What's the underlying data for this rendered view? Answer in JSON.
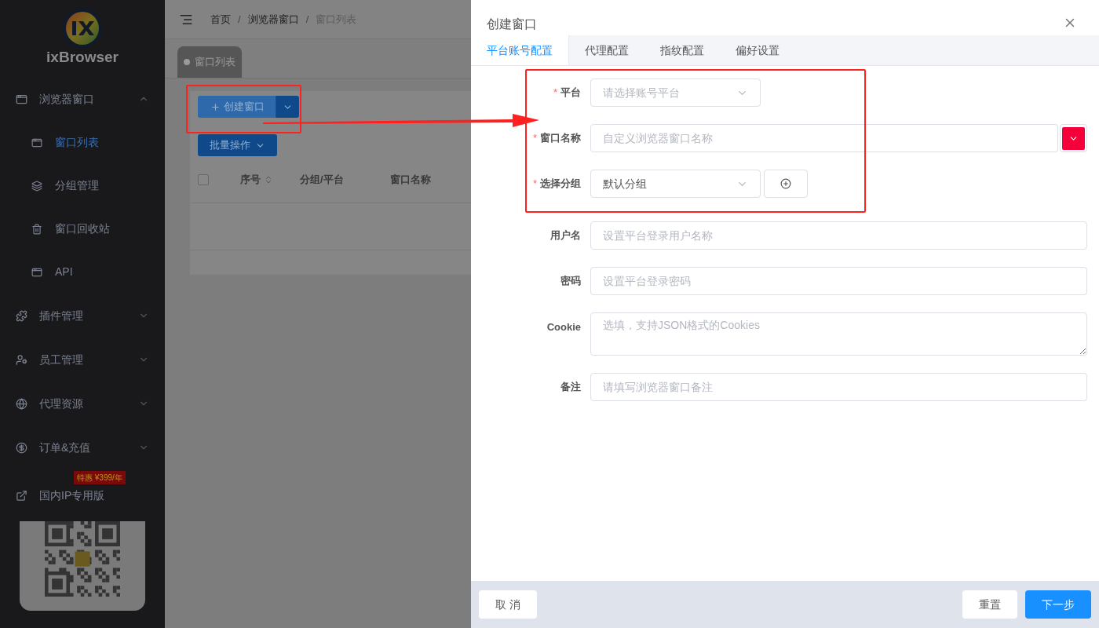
{
  "sidebar": {
    "logo_text": "ixBrowser",
    "items": [
      {
        "label": "浏览器窗口",
        "expanded": true,
        "selected": false,
        "children": [
          {
            "label": "窗口列表",
            "selected": true
          },
          {
            "label": "分组管理",
            "selected": false
          },
          {
            "label": "窗口回收站",
            "selected": false
          },
          {
            "label": "API",
            "selected": false
          }
        ]
      },
      {
        "label": "插件管理",
        "expanded": false,
        "selected": false
      },
      {
        "label": "员工管理",
        "expanded": false,
        "selected": false
      },
      {
        "label": "代理资源",
        "expanded": false,
        "selected": false
      },
      {
        "label": "订单&充值",
        "expanded": false,
        "selected": false
      }
    ],
    "link": {
      "label": "国内IP专用版",
      "badge": "特惠 ¥399/年"
    }
  },
  "breadcrumb": [
    "首页",
    "浏览器窗口",
    "窗口列表"
  ],
  "breadcrumb_separators": [
    "/",
    "/"
  ],
  "page_tabs": [
    {
      "label": "窗口列表",
      "selected": true
    }
  ],
  "toolbar": {
    "create_button": "创建窗口",
    "batch_button": "批量操作"
  },
  "table": {
    "select_all_checked": false,
    "columns": [
      "序号",
      "分组/平台",
      "窗口名称"
    ]
  },
  "drawer": {
    "title": "创建窗口",
    "required_mark": "*",
    "tabs": [
      {
        "label": "平台账号配置",
        "selected": true
      },
      {
        "label": "代理配置",
        "selected": false
      },
      {
        "label": "指纹配置",
        "selected": false
      },
      {
        "label": "偏好设置",
        "selected": false
      }
    ],
    "fields": [
      {
        "label": "平台",
        "required": true,
        "kind": "select",
        "placeholder": "请选择账号平台"
      },
      {
        "label": "窗口名称",
        "required": true,
        "kind": "input",
        "placeholder": "自定义浏览器窗口名称",
        "color": "#f5003b"
      },
      {
        "label": "选择分组",
        "required": true,
        "kind": "select",
        "value": "默认分组",
        "add": true
      },
      {
        "label": "用户名",
        "required": false,
        "kind": "input",
        "placeholder": "设置平台登录用户名称"
      },
      {
        "label": "密码",
        "required": false,
        "kind": "input",
        "placeholder": "设置平台登录密码"
      },
      {
        "label": "Cookie",
        "required": false,
        "kind": "textarea",
        "placeholder": "选填，支持JSON格式的Cookies"
      },
      {
        "label": "备注",
        "required": false,
        "kind": "input",
        "placeholder": "请填写浏览器窗口备注"
      }
    ],
    "footer": {
      "cancel": "取 消",
      "reset": "重置",
      "next": "下一步"
    }
  }
}
